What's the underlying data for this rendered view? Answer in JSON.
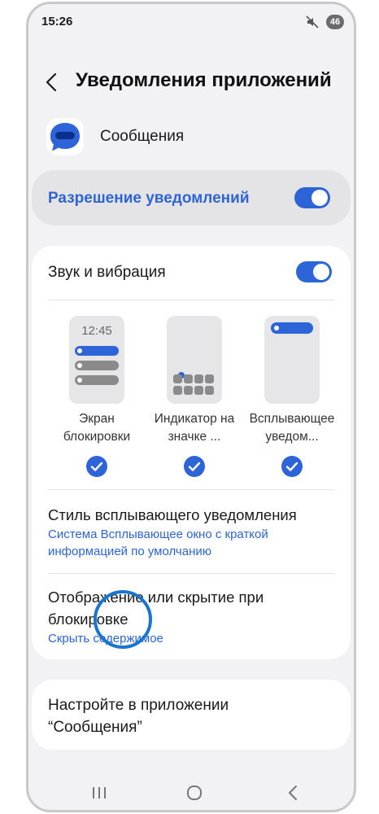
{
  "status_bar": {
    "time": "15:26",
    "battery": "46"
  },
  "header": {
    "title": "Уведомления приложений"
  },
  "app": {
    "name": "Сообщения"
  },
  "permission": {
    "label": "Разрешение уведомлений",
    "enabled": true
  },
  "sound": {
    "label": "Звук и вибрация",
    "enabled": true
  },
  "previews": {
    "lock_time": "12:45",
    "items": [
      {
        "label": "Экран блокировки",
        "checked": true
      },
      {
        "label": "Индикатор на значке ...",
        "checked": true
      },
      {
        "label": "Всплывающее уведом...",
        "checked": true
      }
    ]
  },
  "popup_style": {
    "title": "Стиль всплывающего уведомления",
    "subtitle": "Система Всплывающее окно с краткой информацией по умолчанию"
  },
  "lock_visibility": {
    "title": "Отображение или скрытие при блокировке",
    "subtitle": "Скрыть содержимое"
  },
  "app_settings": {
    "label": "Настройте в приложении “Сообщения”"
  },
  "colors": {
    "accent": "#2d64d8",
    "background": "#f2f2f4",
    "card": "#ffffff",
    "highlight": "#1876d0"
  }
}
